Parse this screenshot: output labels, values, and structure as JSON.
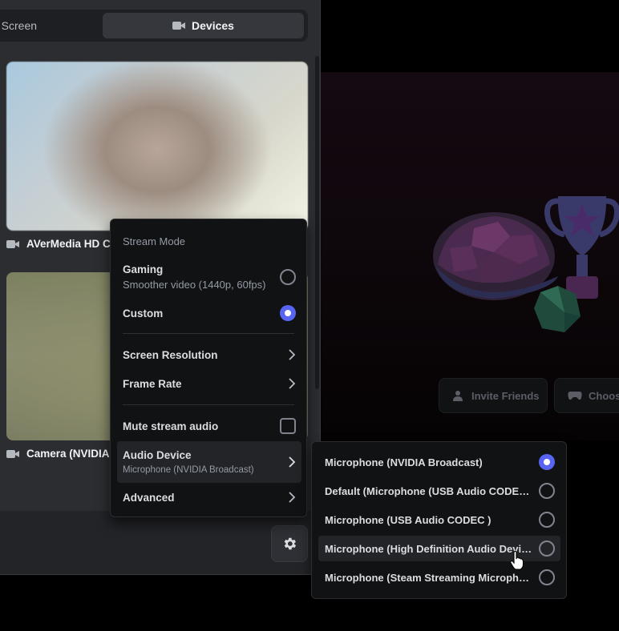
{
  "tabs": {
    "screen_label": "e Screen",
    "devices_label": "Devices"
  },
  "devices": [
    {
      "label": "AVerMedia HD Ca"
    },
    {
      "label": "Camera (NVIDIA I"
    }
  ],
  "stage": {
    "invite_label": "Invite Friends",
    "choose_label": "Choose"
  },
  "stream_menu": {
    "heading": "Stream Mode",
    "gaming": {
      "title": "Gaming",
      "subtitle": "Smoother video (1440p, 60fps)",
      "selected": false
    },
    "custom": {
      "title": "Custom",
      "selected": true
    },
    "screen_resolution": "Screen Resolution",
    "frame_rate": "Frame Rate",
    "mute_stream_audio": {
      "label": "Mute stream audio",
      "checked": false
    },
    "audio_device": {
      "title": "Audio Device",
      "value": "Microphone (NVIDIA Broadcast)"
    },
    "advanced": "Advanced"
  },
  "audio_submenu": {
    "options": [
      {
        "label": "Microphone (NVIDIA Broadcast)",
        "selected": true
      },
      {
        "label": "Default (Microphone (USB Audio CODEC ))",
        "selected": false
      },
      {
        "label": "Microphone (USB Audio CODEC )",
        "selected": false
      },
      {
        "label": "Microphone (High Definition Audio Device)",
        "selected": false
      },
      {
        "label": "Microphone (Steam Streaming Micropho...",
        "selected": false
      }
    ]
  },
  "colors": {
    "accent": "#5865f2",
    "menu_bg": "#111214",
    "panel_bg": "#2b2d31"
  }
}
